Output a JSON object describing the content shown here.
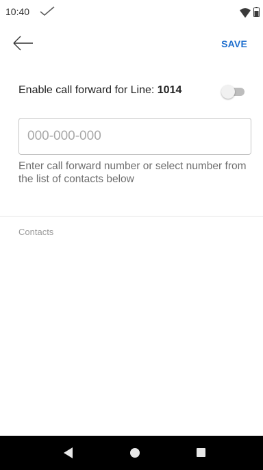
{
  "status_bar": {
    "time": "10:40",
    "icons": [
      "check-icon",
      "wifi-icon",
      "battery-icon"
    ]
  },
  "toolbar": {
    "back_icon": "arrow-left-icon",
    "save_label": "SAVE"
  },
  "call_forward": {
    "enable_label": "Enable call forward for Line: ",
    "line_number": "1014",
    "enabled": false,
    "input_value": "",
    "input_placeholder": "000-000-000",
    "helper_text": "Enter call forward number or select number from the list of contacts below"
  },
  "contacts": {
    "header": "Contacts",
    "items": []
  },
  "nav_bar": {
    "icons": [
      "nav-back-icon",
      "nav-home-icon",
      "nav-recents-icon"
    ]
  },
  "colors": {
    "accent": "#1f6fce",
    "toggle_off_track": "#bdbdbd",
    "nav_background": "#000000"
  }
}
